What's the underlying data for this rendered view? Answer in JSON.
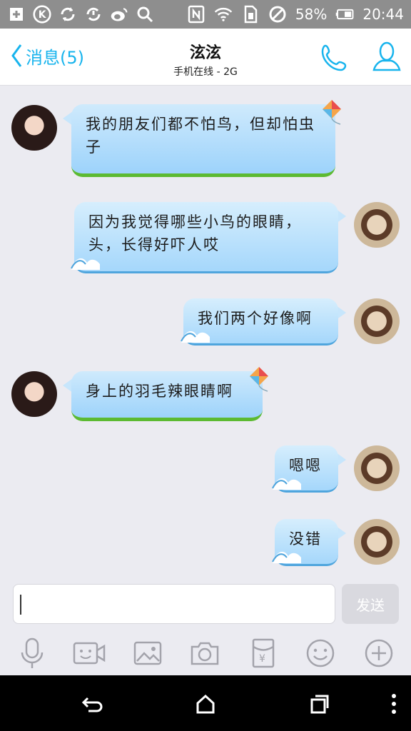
{
  "status_bar": {
    "battery_percent": "58%",
    "time": "20:44",
    "icons": [
      "plus-box-icon",
      "k-app-icon",
      "sync-icon",
      "sync-alert-icon",
      "weibo-icon",
      "search-icon",
      "nfc-icon",
      "wifi-icon",
      "sim-icon",
      "dnd-icon",
      "battery-icon"
    ]
  },
  "header": {
    "back_label": "消息(5)",
    "contact_name": "泫泫",
    "status": "手机在线 - 2G",
    "accent_color": "#18b4ed"
  },
  "messages": [
    {
      "side": "in",
      "text": "我的朋友们都不怕鸟，但却怕虫子"
    },
    {
      "side": "out",
      "text": "因为我觉得哪些小鸟的眼睛，头，长得好吓人哎"
    },
    {
      "side": "out",
      "text": "我们两个好像啊"
    },
    {
      "side": "in",
      "text": "身上的羽毛辣眼睛啊"
    },
    {
      "side": "out",
      "text": "嗯嗯"
    },
    {
      "side": "out",
      "text": "没错"
    }
  ],
  "composer": {
    "input_value": "",
    "send_label": "发送"
  },
  "toolbar_icons": [
    "microphone-icon",
    "video-call-icon",
    "image-icon",
    "camera-icon",
    "red-packet-icon",
    "emoji-icon",
    "plus-circle-icon"
  ],
  "nav_icons": [
    "back-nav-icon",
    "home-nav-icon",
    "recents-nav-icon",
    "menu-nav-icon"
  ]
}
